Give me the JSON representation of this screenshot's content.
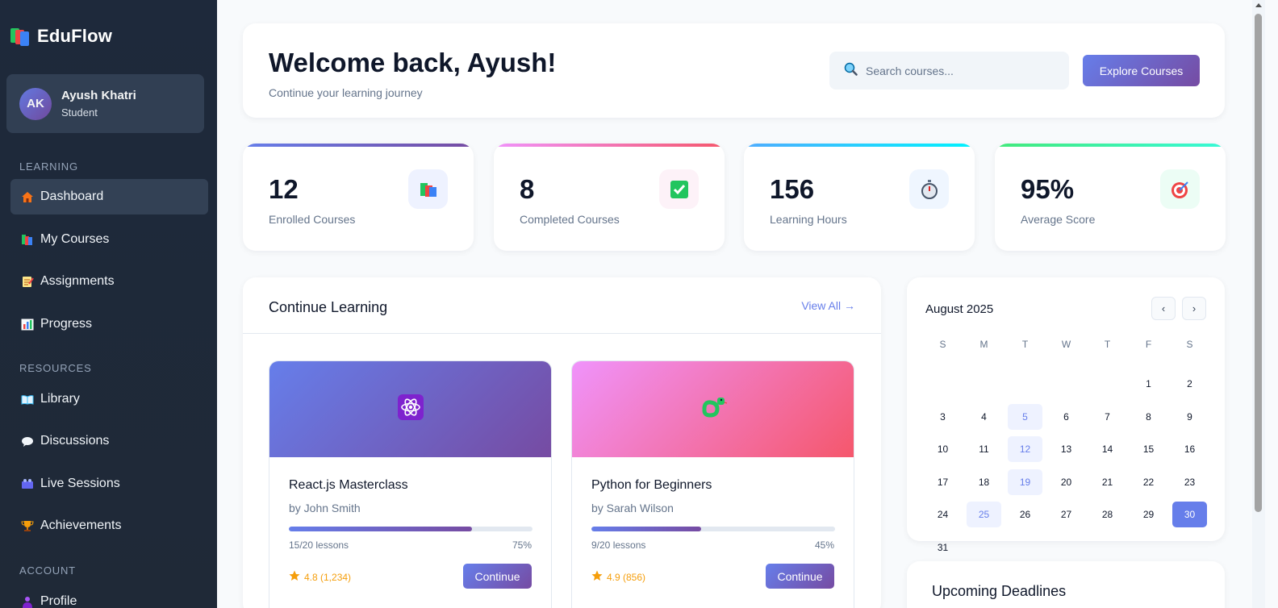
{
  "brand": {
    "name": "EduFlow"
  },
  "user": {
    "initials": "AK",
    "name": "Ayush Khatri",
    "role": "Student"
  },
  "sidebar": {
    "sections": [
      {
        "label": "LEARNING",
        "items": [
          {
            "label": "Dashboard",
            "icon": "home-icon",
            "active": true
          },
          {
            "label": "My Courses",
            "icon": "books-icon"
          },
          {
            "label": "Assignments",
            "icon": "memo-icon"
          },
          {
            "label": "Progress",
            "icon": "bar-chart-icon"
          }
        ]
      },
      {
        "label": "RESOURCES",
        "items": [
          {
            "label": "Library",
            "icon": "open-book-icon"
          },
          {
            "label": "Discussions",
            "icon": "speech-bubble-icon"
          },
          {
            "label": "Live Sessions",
            "icon": "video-icon"
          },
          {
            "label": "Achievements",
            "icon": "trophy-icon"
          }
        ]
      },
      {
        "label": "ACCOUNT",
        "items": [
          {
            "label": "Profile",
            "icon": "person-icon"
          }
        ]
      }
    ]
  },
  "header": {
    "welcome": "Welcome back, Ayush!",
    "subtitle": "Continue your learning journey",
    "search_placeholder": "Search courses...",
    "explore_label": "Explore Courses"
  },
  "stats": [
    {
      "value": "12",
      "label": "Enrolled Courses",
      "icon": "books-icon",
      "accent": "#667eea"
    },
    {
      "value": "8",
      "label": "Completed Courses",
      "icon": "check-box-icon",
      "accent": "#f5576c"
    },
    {
      "value": "156",
      "label": "Learning Hours",
      "icon": "stopwatch-icon",
      "accent": "#00c6fb"
    },
    {
      "value": "95%",
      "label": "Average Score",
      "icon": "target-icon",
      "accent": "#43e97b"
    }
  ],
  "continue_learning": {
    "title": "Continue Learning",
    "view_all": "View All →",
    "courses": [
      {
        "title": "React.js Masterclass",
        "author": "by John Smith",
        "lessons": "15/20 lessons",
        "percent_text": "75%",
        "progress": 0.75,
        "rating": "4.8 (1,234)",
        "button": "Continue",
        "icon": "atom-icon"
      },
      {
        "title": "Python for Beginners",
        "author": "by Sarah Wilson",
        "lessons": "9/20 lessons",
        "percent_text": "45%",
        "progress": 0.45,
        "rating": "4.9 (856)",
        "button": "Continue",
        "icon": "snake-icon"
      }
    ]
  },
  "calendar": {
    "month": "August 2025",
    "prev": "‹",
    "next": "›",
    "weekdays": [
      "S",
      "M",
      "T",
      "W",
      "T",
      "F",
      "S"
    ],
    "first_weekday_index": 5,
    "days_in_month": 31,
    "highlighted": [
      5,
      12,
      19,
      25
    ],
    "today": 30
  },
  "deadlines": {
    "title": "Upcoming Deadlines"
  },
  "colors": {
    "brand_gradient_start": "#667eea",
    "brand_gradient_end": "#764ba2",
    "rating": "#f59e0b"
  }
}
